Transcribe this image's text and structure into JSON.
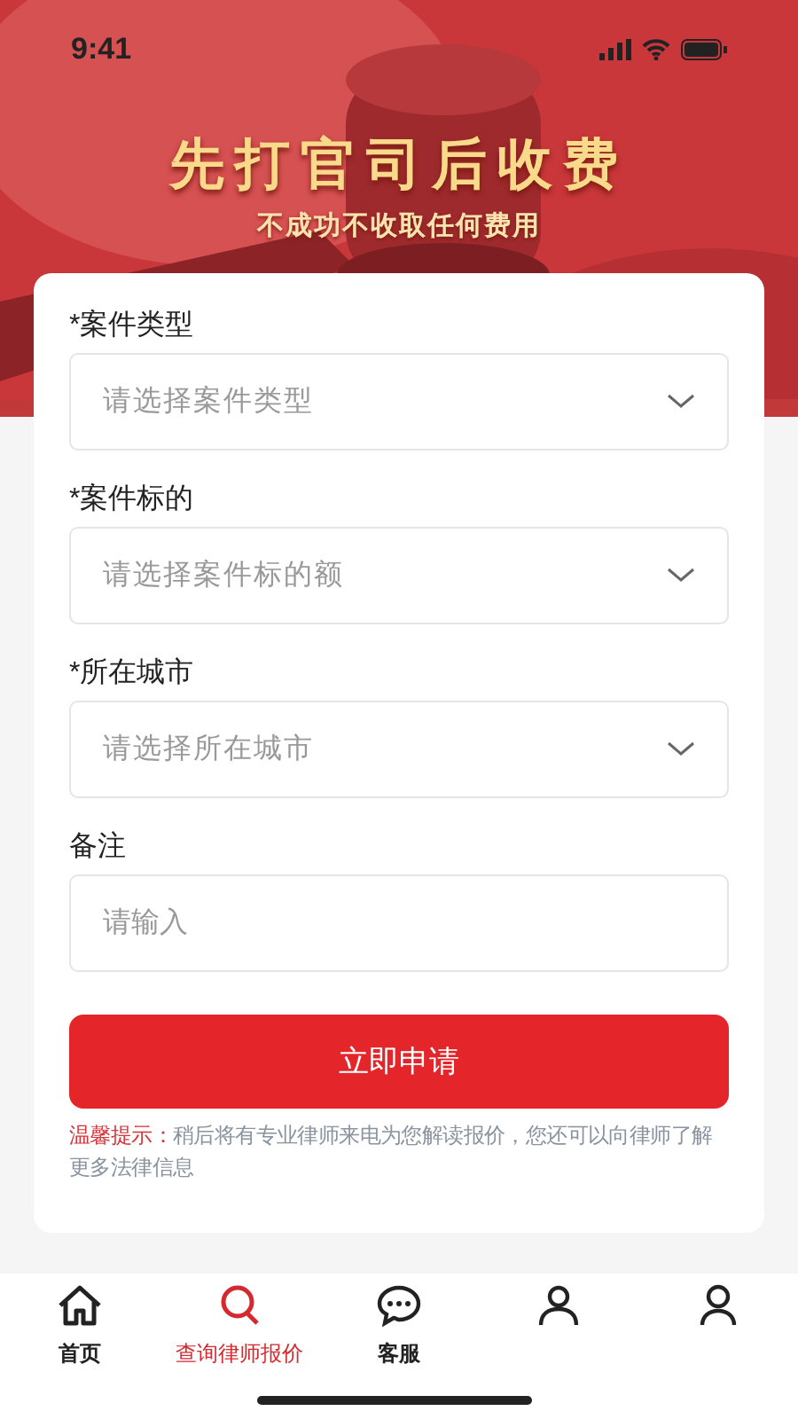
{
  "status_bar": {
    "time": "9:41"
  },
  "banner": {
    "title": "先打官司后收费",
    "subtitle": "不成功不收取任何费用"
  },
  "form": {
    "fields": [
      {
        "kind": "select",
        "label": "*案件类型",
        "placeholder": "请选择案件类型"
      },
      {
        "kind": "select",
        "label": "*案件标的",
        "placeholder": "请选择案件标的额"
      },
      {
        "kind": "select",
        "label": "*所在城市",
        "placeholder": "请选择所在城市"
      },
      {
        "kind": "input",
        "label": "备注",
        "placeholder": "请输入"
      }
    ],
    "submit": "立即申请",
    "notice": {
      "prefix": "温馨提示：",
      "text": "稍后将有专业律师来电为您解读报价，您还可以向律师了解更多法律信息"
    }
  },
  "tab_bar": [
    {
      "kind": "home",
      "label": "首页",
      "selected": false
    },
    {
      "kind": "search",
      "label": "查询律师报价",
      "selected": true
    },
    {
      "kind": "chat",
      "label": "客服",
      "selected": false
    },
    {
      "kind": "person",
      "selected": false
    },
    {
      "kind": "user",
      "selected": false
    }
  ]
}
